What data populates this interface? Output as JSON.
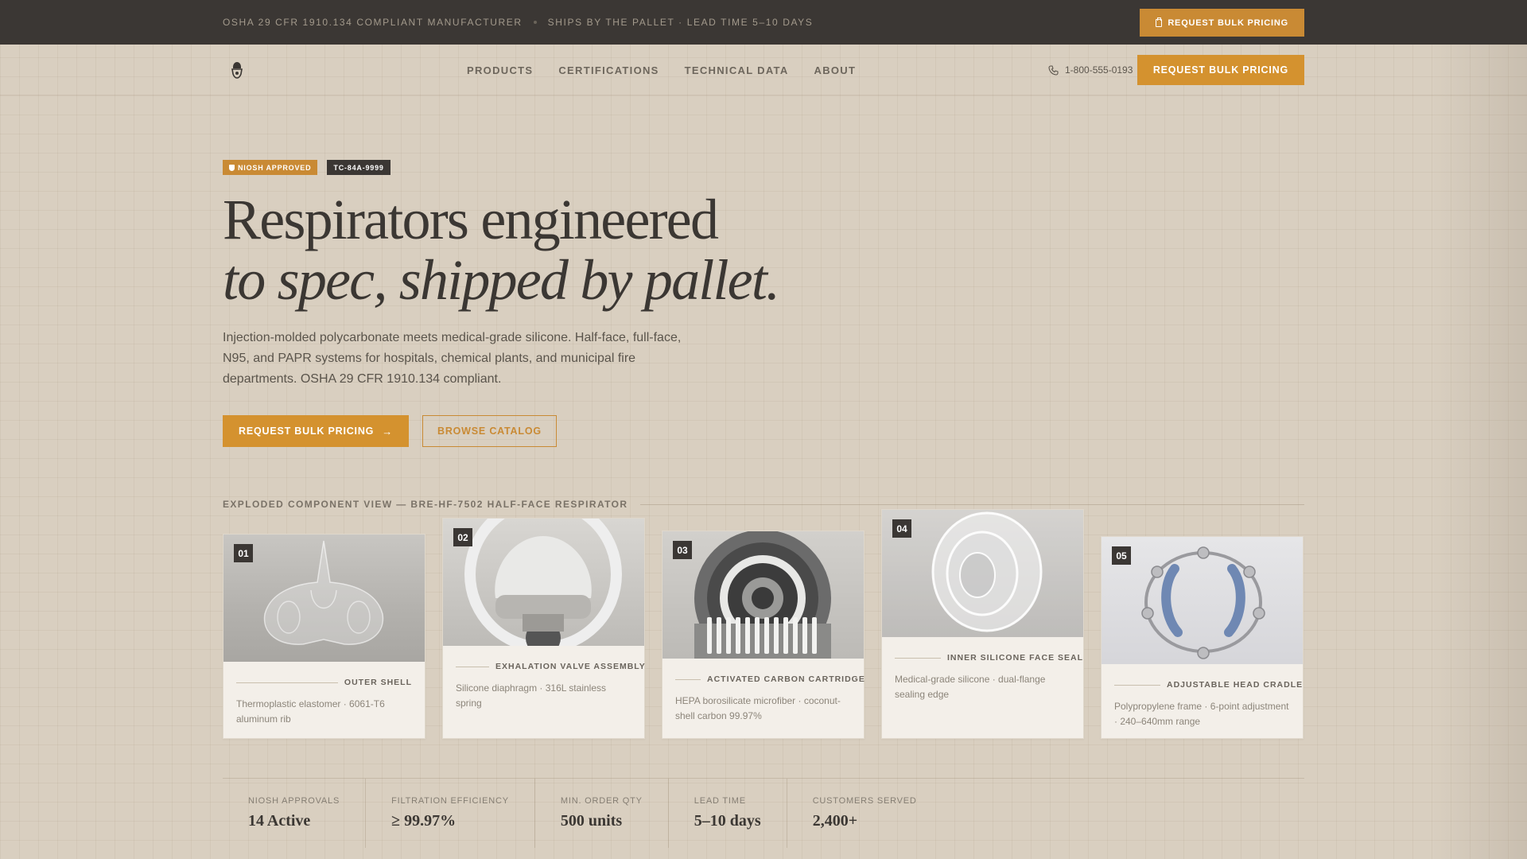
{
  "topbar": {
    "notice_1": "OSHA 29 CFR 1910.134 COMPLIANT MANUFACTURER",
    "notice_2": "SHIPS BY THE PALLET · LEAD TIME 5–10 DAYS",
    "cta_label": "REQUEST BULK PRICING",
    "cta_icon": "clipboard-icon"
  },
  "nav": {
    "logo_icon": "respirator-logo-icon",
    "links": [
      "PRODUCTS",
      "CERTIFICATIONS",
      "TECHNICAL DATA",
      "ABOUT"
    ],
    "phone": "1-800-555-0193",
    "phone_icon": "phone-icon",
    "cta_label": "REQUEST BULK PRICING"
  },
  "hero": {
    "badge_primary": "NIOSH APPROVED",
    "badge_primary_icon": "shield-icon",
    "badge_secondary": "TC-84A-9999",
    "headline_line1": "Respirators engineered",
    "headline_line2": "to spec, shipped by pallet.",
    "lede": "Injection-molded polycarbonate meets medical-grade silicone. Half-face, full-face, N95, and PAPR systems for hospitals, chemical plants, and municipal fire departments. OSHA 29 CFR 1910.134 compliant.",
    "primary_cta": "REQUEST BULK PRICING",
    "primary_cta_icon": "arrow-right-icon",
    "secondary_cta": "BROWSE CATALOG"
  },
  "components": {
    "title": "EXPLODED COMPONENT VIEW — BRE-HF-7502 HALF-FACE RESPIRATOR",
    "items": [
      {
        "num": "01",
        "name": "OUTER SHELL",
        "desc": "Thermoplastic elastomer · 6061-T6 aluminum rib"
      },
      {
        "num": "02",
        "name": "EXHALATION VALVE ASSEMBLY",
        "desc": "Silicone diaphragm · 316L stainless spring"
      },
      {
        "num": "03",
        "name": "ACTIVATED CARBON CARTRIDGE",
        "desc": "HEPA borosilicate microfiber · coconut-shell carbon 99.97%"
      },
      {
        "num": "04",
        "name": "INNER SILICONE FACE SEAL",
        "desc": "Medical-grade silicone · dual-flange sealing edge"
      },
      {
        "num": "05",
        "name": "ADJUSTABLE HEAD CRADLE",
        "desc": "Polypropylene frame · 6-point adjustment · 240–640mm range"
      }
    ]
  },
  "stats": [
    {
      "label": "NIOSH APPROVALS",
      "value": "14 Active"
    },
    {
      "label": "FILTRATION EFFICIENCY",
      "value": "≥ 99.97%"
    },
    {
      "label": "MIN. ORDER QTY",
      "value": "500 units"
    },
    {
      "label": "LEAD TIME",
      "value": "5–10 days"
    },
    {
      "label": "CUSTOMERS SERVED",
      "value": "2,400+"
    }
  ],
  "colors": {
    "page_bg": "#d9cfc0",
    "topbar_bg": "#3b3734",
    "accent": "#d4922f",
    "card_bg": "#f3efe9",
    "text_dark": "#3b3733"
  }
}
